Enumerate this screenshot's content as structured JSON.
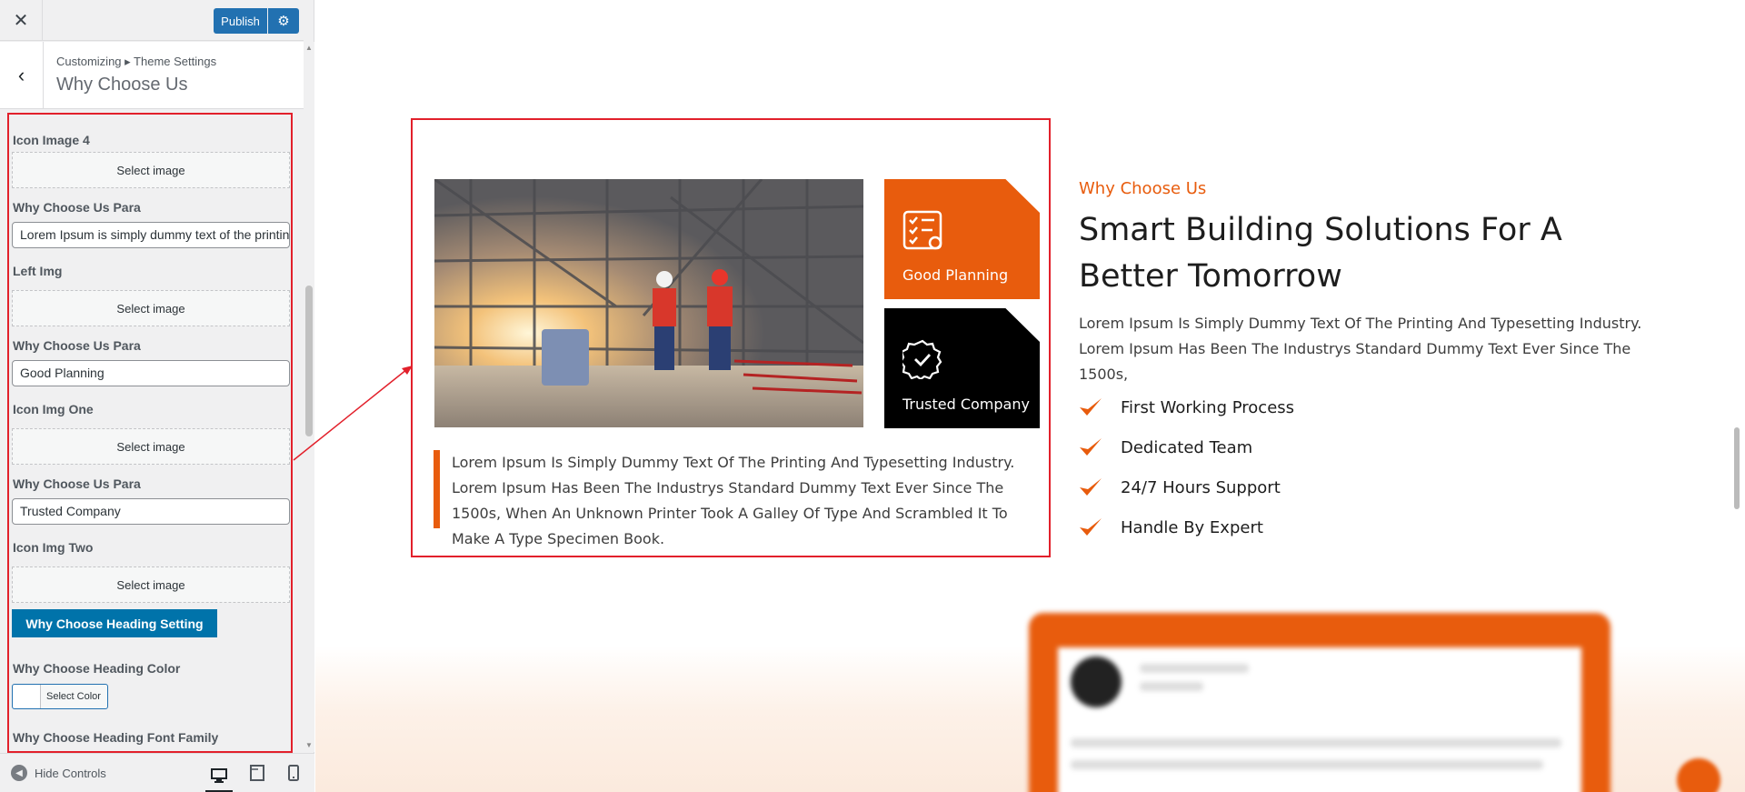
{
  "topbar": {
    "close_label": "✕",
    "publish_label": "Publish"
  },
  "section": {
    "breadcrumb": "Customizing ▸ Theme Settings",
    "title": "Why Choose Us"
  },
  "controls": [
    {
      "label": "Icon Image 4",
      "type": "image",
      "button": "Select image"
    },
    {
      "label": "Why Choose Us Para",
      "type": "text",
      "value": "Lorem Ipsum is simply dummy text of the printing"
    },
    {
      "label": "Left Img",
      "type": "image",
      "button": "Select image"
    },
    {
      "label": "Why Choose Us Para",
      "type": "text",
      "value": "Good Planning"
    },
    {
      "label": "Icon Img One",
      "type": "image",
      "button": "Select image"
    },
    {
      "label": "Why Choose Us Para",
      "type": "text",
      "value": "Trusted Company"
    },
    {
      "label": "Icon Img Two",
      "type": "image",
      "button": "Select image"
    }
  ],
  "heading_setting_button": "Why Choose Heading Setting",
  "heading_color": {
    "label": "Why Choose Heading Color",
    "button": "Select Color"
  },
  "heading_font_label": "Why Choose Heading Font Family",
  "footer": {
    "hide_controls": "Hide Controls"
  },
  "preview": {
    "cards": [
      {
        "title": "Good Planning",
        "icon": "checklist-icon",
        "color": "#e85c0d"
      },
      {
        "title": "Trusted Company",
        "icon": "badge-check-icon",
        "color": "#000000"
      }
    ],
    "quote": "Lorem Ipsum Is Simply Dummy Text Of The Printing And Typesetting Industry. Lorem Ipsum Has Been The Industrys Standard Dummy Text Ever Since The 1500s, When An Unknown Printer Took A Galley Of Type And Scrambled It To Make A Type Specimen Book.",
    "subtitle": "Why Choose Us",
    "title": "Smart Building Solutions For A Better Tomorrow",
    "paragraph": "Lorem Ipsum Is Simply Dummy Text Of The Printing And Typesetting Industry. Lorem Ipsum Has Been The Industrys Standard Dummy Text Ever Since The 1500s,",
    "checklist": [
      "First Working Process",
      "Dedicated Team",
      "24/7 Hours Support",
      "Handle By Expert"
    ],
    "accent_color": "#e85c0d"
  },
  "colors": {
    "wp_blue": "#2271b1",
    "highlight_red": "#e2202b"
  }
}
